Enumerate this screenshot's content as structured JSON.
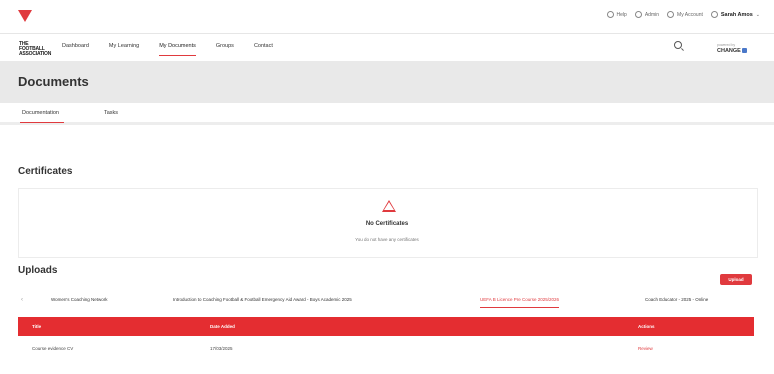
{
  "top_bar": {
    "links": [
      "Help",
      "Admin",
      "My Account"
    ],
    "user_name": "Sarah Amos"
  },
  "nav": {
    "brand": "THE FOOTBALL ASSOCIATION",
    "items": [
      "Dashboard",
      "My Learning",
      "My Documents",
      "Groups",
      "Contact"
    ],
    "active": "My Documents",
    "right_brand_small": "powered by",
    "right_brand": "CHANGE"
  },
  "page": {
    "title": "Documents",
    "tabs": [
      "Documentation",
      "Tasks"
    ]
  },
  "certificates": {
    "title": "Certificates",
    "empty_title": "No Certificates",
    "empty_sub": "You do not have any certificates"
  },
  "uploads": {
    "title": "Uploads",
    "button": "Upload",
    "prev_arrow": "‹",
    "filters": [
      "Women's Coaching Network",
      "Introduction to Coaching Football & Football Emergency Aid Award - Boys Academic 2025",
      "UEFA B Licence Pre Course 2025/2026",
      "Coach Educator - 2025 - Online"
    ],
    "table": {
      "headers": [
        "Title",
        "Date Added",
        "Actions"
      ],
      "rows": [
        {
          "title": "Course evidence CV",
          "date": "17/03/2025",
          "action": "Review"
        }
      ]
    }
  },
  "colors": {
    "accent": "#e03a3e",
    "header_bg": "#e9e9e9",
    "table_head": "#e42d31"
  }
}
